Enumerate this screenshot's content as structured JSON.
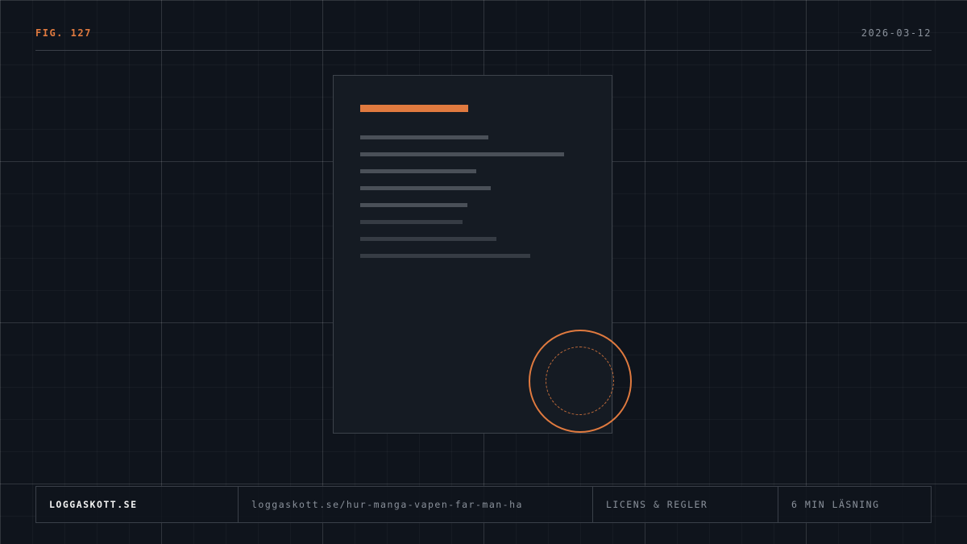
{
  "header": {
    "figure_label": "FIG. 127",
    "date": "2026-03-12"
  },
  "illustration": {
    "document_icon": "document-icon",
    "seal_icon": "seal-icon"
  },
  "footer": {
    "site": "LOGGASKOTT.SE",
    "url": "loggaskott.se/hur-manga-vapen-far-man-ha",
    "license": "LICENS & REGLER",
    "reading_time": "6 MIN LÄSNING"
  },
  "colors": {
    "accent": "#e07a3f",
    "background": "#0f141c"
  }
}
